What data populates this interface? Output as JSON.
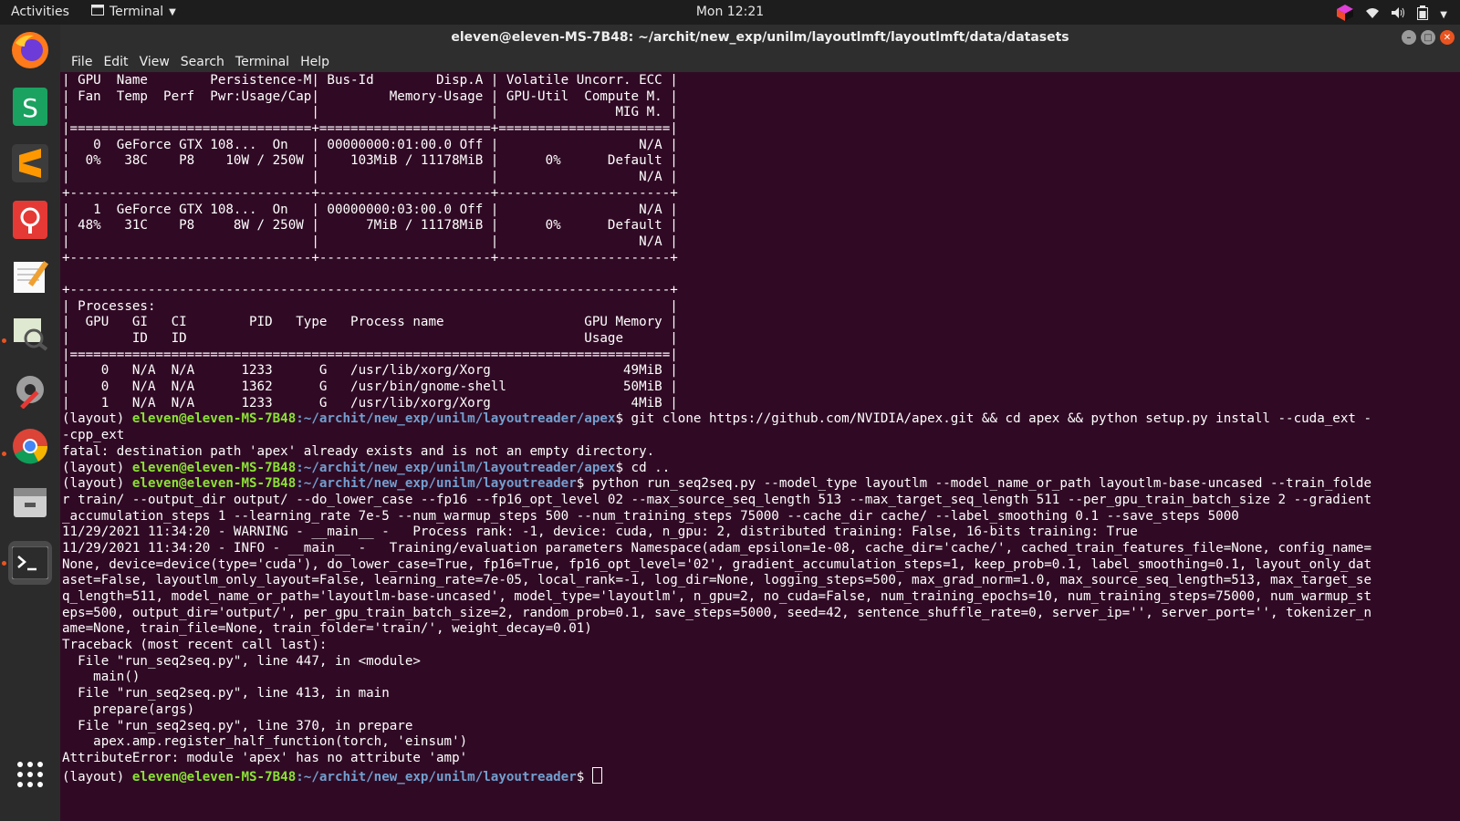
{
  "topbar": {
    "activities": "Activities",
    "app_name": "Terminal",
    "clock": "Mon 12:21"
  },
  "window": {
    "title": "eleven@eleven-MS-7B48: ~/archit/new_exp/unilm/layoutlmft/layoutlmft/data/datasets"
  },
  "menu": [
    "File",
    "Edit",
    "View",
    "Search",
    "Terminal",
    "Help"
  ],
  "colors": {
    "accent": "#e95420",
    "user_host": "#8ae234",
    "path": "#729fcf",
    "terminal_bg": "#300a24"
  },
  "dock": [
    "firefox-icon",
    "spreadsheet-icon",
    "sublime-text-icon",
    "presentation-icon",
    "text-editor-icon",
    "image-viewer-icon",
    "settings-tools-icon",
    "chrome-icon",
    "file-manager-icon",
    "terminal-icon",
    "apps-grid-icon"
  ],
  "terminal_lines": [
    {
      "text": "| GPU  Name        Persistence-M| Bus-Id        Disp.A | Volatile Uncorr. ECC |"
    },
    {
      "text": "| Fan  Temp  Perf  Pwr:Usage/Cap|         Memory-Usage | GPU-Util  Compute M. |"
    },
    {
      "text": "|                               |                      |               MIG M. |"
    },
    {
      "text": "|===============================+======================+======================|"
    },
    {
      "text": "|   0  GeForce GTX 108...  On   | 00000000:01:00.0 Off |                  N/A |"
    },
    {
      "text": "|  0%   38C    P8    10W / 250W |    103MiB / 11178MiB |      0%      Default |"
    },
    {
      "text": "|                               |                      |                  N/A |"
    },
    {
      "text": "+-------------------------------+----------------------+----------------------+"
    },
    {
      "text": "|   1  GeForce GTX 108...  On   | 00000000:03:00.0 Off |                  N/A |"
    },
    {
      "text": "| 48%   31C    P8     8W / 250W |      7MiB / 11178MiB |      0%      Default |"
    },
    {
      "text": "|                               |                      |                  N/A |"
    },
    {
      "text": "+-------------------------------+----------------------+----------------------+"
    },
    {
      "text": ""
    },
    {
      "text": "+-----------------------------------------------------------------------------+"
    },
    {
      "text": "| Processes:                                                                  |"
    },
    {
      "text": "|  GPU   GI   CI        PID   Type   Process name                  GPU Memory |"
    },
    {
      "text": "|        ID   ID                                                   Usage      |"
    },
    {
      "text": "|=============================================================================|"
    },
    {
      "text": "|    0   N/A  N/A      1233      G   /usr/lib/xorg/Xorg                 49MiB |"
    },
    {
      "text": "|    0   N/A  N/A      1362      G   /usr/bin/gnome-shell               50MiB |"
    },
    {
      "text": "|    1   N/A  N/A      1233      G   /usr/lib/xorg/Xorg                  4MiB |"
    },
    {
      "pre": "(layout) ",
      "user": "eleven@eleven-MS-7B48",
      "path": ":~/archit/new_exp/unilm/layoutreader/apex",
      "text": "$ git clone https://github.com/NVIDIA/apex.git && cd apex && python setup.py install --cuda_ext -"
    },
    {
      "text": "-cpp_ext"
    },
    {
      "text": "fatal: destination path 'apex' already exists and is not an empty directory."
    },
    {
      "pre": "(layout) ",
      "user": "eleven@eleven-MS-7B48",
      "path": ":~/archit/new_exp/unilm/layoutreader/apex",
      "text": "$ cd .."
    },
    {
      "pre": "(layout) ",
      "user": "eleven@eleven-MS-7B48",
      "path": ":~/archit/new_exp/unilm/layoutreader",
      "text": "$ python run_seq2seq.py --model_type layoutlm --model_name_or_path layoutlm-base-uncased --train_folde"
    },
    {
      "text": "r train/ --output_dir output/ --do_lower_case --fp16 --fp16_opt_level 02 --max_source_seq_length 513 --max_target_seq_length 511 --per_gpu_train_batch_size 2 --gradient"
    },
    {
      "text": "_accumulation_steps 1 --learning_rate 7e-5 --num_warmup_steps 500 --num_training_steps 75000 --cache_dir cache/ --label_smoothing 0.1 --save_steps 5000"
    },
    {
      "text": "11/29/2021 11:34:20 - WARNING - __main__ -   Process rank: -1, device: cuda, n_gpu: 2, distributed training: False, 16-bits training: True"
    },
    {
      "text": "11/29/2021 11:34:20 - INFO - __main__ -   Training/evaluation parameters Namespace(adam_epsilon=1e-08, cache_dir='cache/', cached_train_features_file=None, config_name="
    },
    {
      "text": "None, device=device(type='cuda'), do_lower_case=True, fp16=True, fp16_opt_level='02', gradient_accumulation_steps=1, keep_prob=0.1, label_smoothing=0.1, layout_only_dat"
    },
    {
      "text": "aset=False, layoutlm_only_layout=False, learning_rate=7e-05, local_rank=-1, log_dir=None, logging_steps=500, max_grad_norm=1.0, max_source_seq_length=513, max_target_se"
    },
    {
      "text": "q_length=511, model_name_or_path='layoutlm-base-uncased', model_type='layoutlm', n_gpu=2, no_cuda=False, num_training_epochs=10, num_training_steps=75000, num_warmup_st"
    },
    {
      "text": "eps=500, output_dir='output/', per_gpu_train_batch_size=2, random_prob=0.1, save_steps=5000, seed=42, sentence_shuffle_rate=0, server_ip='', server_port='', tokenizer_n"
    },
    {
      "text": "ame=None, train_file=None, train_folder='train/', weight_decay=0.01)"
    },
    {
      "text": "Traceback (most recent call last):"
    },
    {
      "text": "  File \"run_seq2seq.py\", line 447, in <module>"
    },
    {
      "text": "    main()"
    },
    {
      "text": "  File \"run_seq2seq.py\", line 413, in main"
    },
    {
      "text": "    prepare(args)"
    },
    {
      "text": "  File \"run_seq2seq.py\", line 370, in prepare"
    },
    {
      "text": "    apex.amp.register_half_function(torch, 'einsum')"
    },
    {
      "text": "AttributeError: module 'apex' has no attribute 'amp'"
    },
    {
      "pre": "(layout) ",
      "user": "eleven@eleven-MS-7B48",
      "path": ":~/archit/new_exp/unilm/layoutreader",
      "text": "$ ",
      "cursor": true
    }
  ]
}
